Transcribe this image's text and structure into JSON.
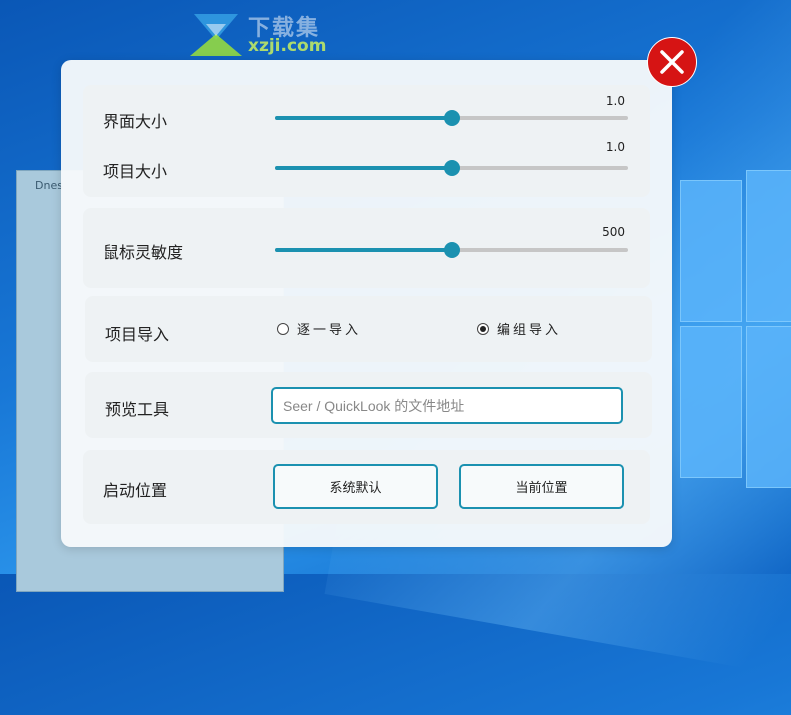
{
  "watermark": {
    "cn": "下载集",
    "url": "xzji.com"
  },
  "background_window": {
    "title": "Dnes"
  },
  "settings": {
    "interface_size": {
      "label": "界面大小",
      "value": "1.0",
      "fraction": 0.5
    },
    "item_size": {
      "label": "项目大小",
      "value": "1.0",
      "fraction": 0.5
    },
    "mouse_sensitivity": {
      "label": "鼠标灵敏度",
      "value": "500",
      "fraction": 0.5
    },
    "item_import": {
      "label": "项目导入",
      "options": [
        {
          "label": "逐一导入",
          "selected": false
        },
        {
          "label": "编组导入",
          "selected": true
        }
      ]
    },
    "preview_tool": {
      "label": "预览工具",
      "value": "",
      "placeholder": "Seer / QuickLook 的文件地址"
    },
    "launch_position": {
      "label": "启动位置",
      "buttons": [
        "系统默认",
        "当前位置"
      ]
    }
  },
  "colors": {
    "accent": "#1b91b0",
    "close": "#d61414"
  }
}
